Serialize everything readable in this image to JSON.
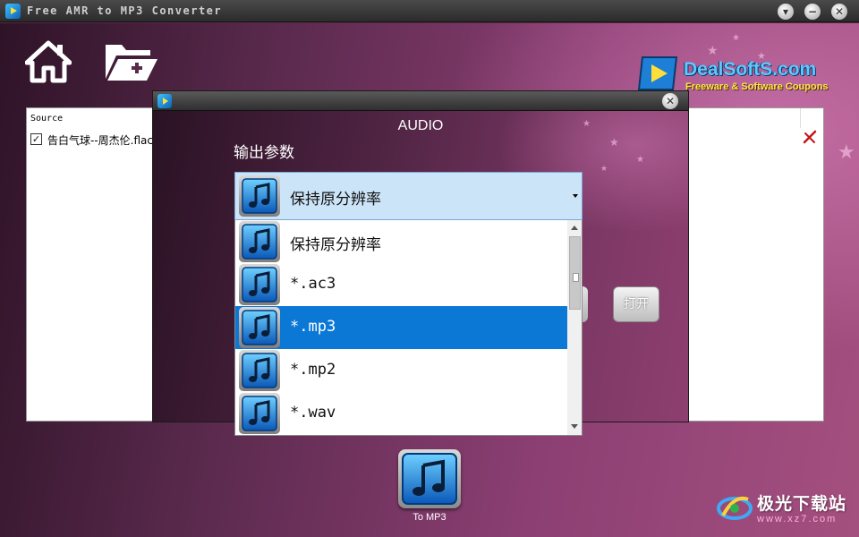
{
  "window": {
    "title": "Free AMR to MP3 Converter",
    "controls": {
      "dropdown": "▾",
      "minimize": "−",
      "close": "✕"
    }
  },
  "brand": {
    "name": "DealSoftS.com",
    "tagline": "Freeware & Software Coupons"
  },
  "source_list": {
    "header": "Source",
    "files": [
      {
        "checked": true,
        "check_glyph": "✓",
        "name": "告白气球--周杰伦.flac"
      }
    ]
  },
  "convert": {
    "label": "To MP3"
  },
  "dialog": {
    "heading": "AUDIO",
    "close": "✕",
    "output_label": "输出参数",
    "open_button": "打开",
    "select": {
      "selected_value": "保持原分辨率",
      "options": [
        {
          "label": "保持原分辨率"
        },
        {
          "label": "*.ac3"
        },
        {
          "label": "*.mp3",
          "highlighted": true
        },
        {
          "label": "*.mp2"
        },
        {
          "label": "*.wav"
        }
      ]
    }
  },
  "watermark": {
    "text": "极光下载站",
    "url": "www.xz7.com"
  },
  "colors": {
    "accent_blue": "#0b78d6",
    "brand_blue": "#5fc8ff",
    "brand_yellow": "#ffe84a",
    "select_bg": "#cce4f7"
  },
  "icons": {
    "home": "home-icon",
    "add_folder": "add-folder-icon",
    "delete": "delete-icon",
    "music_note": "music-note-icon"
  }
}
